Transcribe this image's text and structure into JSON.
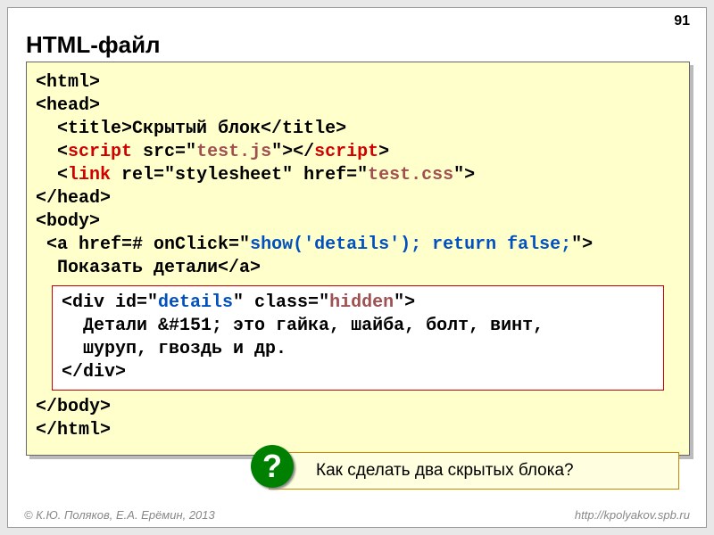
{
  "page_number": "91",
  "title": "HTML-файл",
  "code": {
    "l1": "<html>",
    "l2": "<head>",
    "l3a": "  <title>Скрытый блок</title>",
    "l4_open": "  <",
    "l4_script": "script",
    "l4_mid": " src=\"",
    "l4_file": "test.js",
    "l4_close1": "\"></",
    "l4_close2": ">",
    "l5_open": "  <",
    "l5_link": "link",
    "l5_mid": " rel=\"stylesheet\" href=\"",
    "l5_file": "test.css",
    "l5_close": "\">",
    "l6": "</head>",
    "l7": "<body>",
    "l8a": " <a href=# onClick=\"",
    "l8b": "show('details'); return false;",
    "l8c": "\">",
    "l9": "  Показать детали</a>",
    "inner1a": "<div id=\"",
    "inner1b": "details",
    "inner1c": "\" class=\"",
    "inner1d": "hidden",
    "inner1e": "\">",
    "inner2": "  Детали &#151; это гайка, шайба, болт, винт,",
    "inner3": "  шуруп, гвоздь и др.",
    "inner4": "</div>",
    "l10": "</body>",
    "l11": "</html>"
  },
  "question_mark": "?",
  "question_text": "Как сделать два скрытых блока?",
  "footer_left": "© К.Ю. Поляков, Е.А. Ерёмин, 2013",
  "footer_right": "http://kpolyakov.spb.ru"
}
